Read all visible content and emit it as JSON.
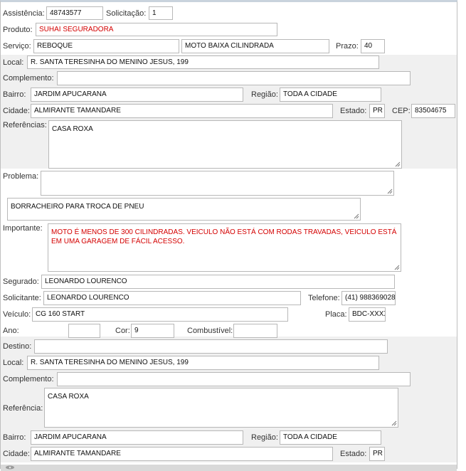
{
  "assistencia": {
    "label": "Assistência:",
    "value": "48743577"
  },
  "solicitacao": {
    "label": "Solicitação:",
    "value": "1"
  },
  "produto": {
    "label": "Produto:",
    "value": "SUHAI SEGURADORA"
  },
  "servico": {
    "label": "Serviço:",
    "value": "REBOQUE",
    "tipo": "MOTO BAIXA CILINDRADA"
  },
  "prazo": {
    "label": "Prazo:",
    "value": "40"
  },
  "local": {
    "label": "Local:",
    "value": "R. SANTA TERESINHA DO MENINO JESUS, 199"
  },
  "complemento": {
    "label": "Complemento:",
    "value": ""
  },
  "bairro": {
    "label": "Bairro:",
    "value": "JARDIM APUCARANA"
  },
  "regiao": {
    "label": "Região:",
    "value": "TODA A CIDADE"
  },
  "cidade": {
    "label": "Cidade:",
    "value": "ALMIRANTE TAMANDARE"
  },
  "estado": {
    "label": "Estado:",
    "value": "PR"
  },
  "cep": {
    "label": "CEP:",
    "value": "83504675"
  },
  "referencias": {
    "label": "Referências:",
    "value": "CASA ROXA"
  },
  "problema": {
    "label": "Problema:",
    "value": "",
    "detalhe": "BORRACHEIRO PARA TROCA DE PNEU"
  },
  "importante": {
    "label": "Importante:",
    "value": "MOTO É MENOS DE 300 CILINDRADAS. VEICULO NÃO ESTÁ COM RODAS TRAVADAS, VEICULO ESTÁ EM UMA GARAGEM DE FÁCIL ACESSO."
  },
  "segurado": {
    "label": "Segurado:",
    "value": "LEONARDO LOURENCO"
  },
  "solicitante": {
    "label": "Solicitante:",
    "value": "LEONARDO LOURENCO"
  },
  "telefone": {
    "label": "Telefone:",
    "value": "(41) 988369028"
  },
  "veiculo": {
    "label": "Veículo:",
    "value": "CG 160 START"
  },
  "placa": {
    "label": "Placa:",
    "value": "BDC-XXXX"
  },
  "ano": {
    "label": "Ano:",
    "value": ""
  },
  "cor": {
    "label": "Cor:",
    "value": "9"
  },
  "combustivel": {
    "label": "Combustível:",
    "value": ""
  },
  "destino": {
    "label": "Destino:",
    "value": "",
    "local_label": "Local:",
    "local": "R. SANTA TERESINHA DO MENINO JESUS, 199",
    "complemento_label": "Complemento:",
    "complemento": "",
    "referencia_label": "Referência:",
    "referencia": "CASA ROXA",
    "bairro_label": "Bairro:",
    "bairro": "JARDIM APUCARANA",
    "regiao_label": "Região:",
    "regiao": "TODA A CIDADE",
    "cidade_label": "Cidade:",
    "cidade": "ALMIRANTE TAMANDARE",
    "estado_label": "Estado:",
    "estado": "PR"
  },
  "colors": {
    "band": "#f0f0f0",
    "alert_text": "#d40000",
    "border": "#b8b8b8"
  }
}
